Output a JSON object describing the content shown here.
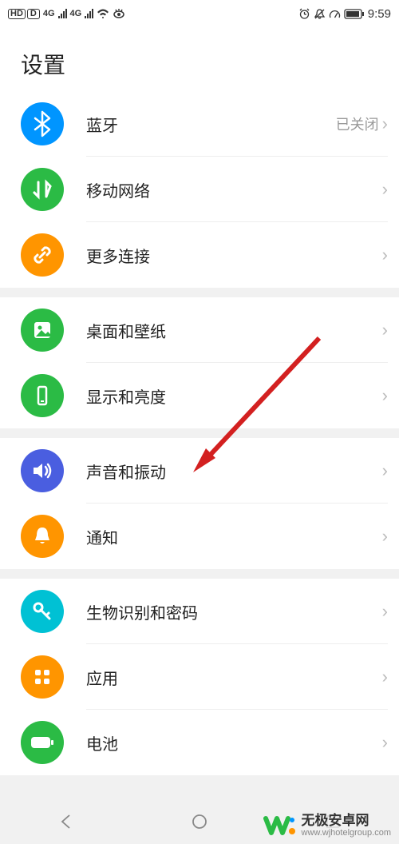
{
  "status_bar": {
    "hd": "HD",
    "n": "D",
    "net1": "4G",
    "net2": "4G",
    "time": "9:59"
  },
  "header": {
    "title": "设置"
  },
  "sections": [
    {
      "items": [
        {
          "key": "bluetooth",
          "label": "蓝牙",
          "value": "已关闭",
          "icon": "bluetooth-icon",
          "color": "bg-blue"
        },
        {
          "key": "mobile_network",
          "label": "移动网络",
          "value": "",
          "icon": "mobile-network-icon",
          "color": "bg-green"
        },
        {
          "key": "more_connections",
          "label": "更多连接",
          "value": "",
          "icon": "link-icon",
          "color": "bg-orange"
        }
      ]
    },
    {
      "items": [
        {
          "key": "wallpaper",
          "label": "桌面和壁纸",
          "value": "",
          "icon": "image-icon",
          "color": "bg-green"
        },
        {
          "key": "display",
          "label": "显示和亮度",
          "value": "",
          "icon": "phone-icon",
          "color": "bg-green"
        }
      ]
    },
    {
      "items": [
        {
          "key": "sound",
          "label": "声音和振动",
          "value": "",
          "icon": "sound-icon",
          "color": "bg-indigo"
        },
        {
          "key": "notification",
          "label": "通知",
          "value": "",
          "icon": "bell-icon",
          "color": "bg-orange"
        }
      ]
    },
    {
      "items": [
        {
          "key": "biometric",
          "label": "生物识别和密码",
          "value": "",
          "icon": "key-icon",
          "color": "bg-cyan"
        },
        {
          "key": "apps",
          "label": "应用",
          "value": "",
          "icon": "grid-icon",
          "color": "bg-orange"
        },
        {
          "key": "battery",
          "label": "电池",
          "value": "",
          "icon": "battery-icon",
          "color": "bg-green"
        }
      ]
    }
  ],
  "watermark": {
    "title": "无极安卓网",
    "url": "www.wjhotelgroup.com"
  }
}
